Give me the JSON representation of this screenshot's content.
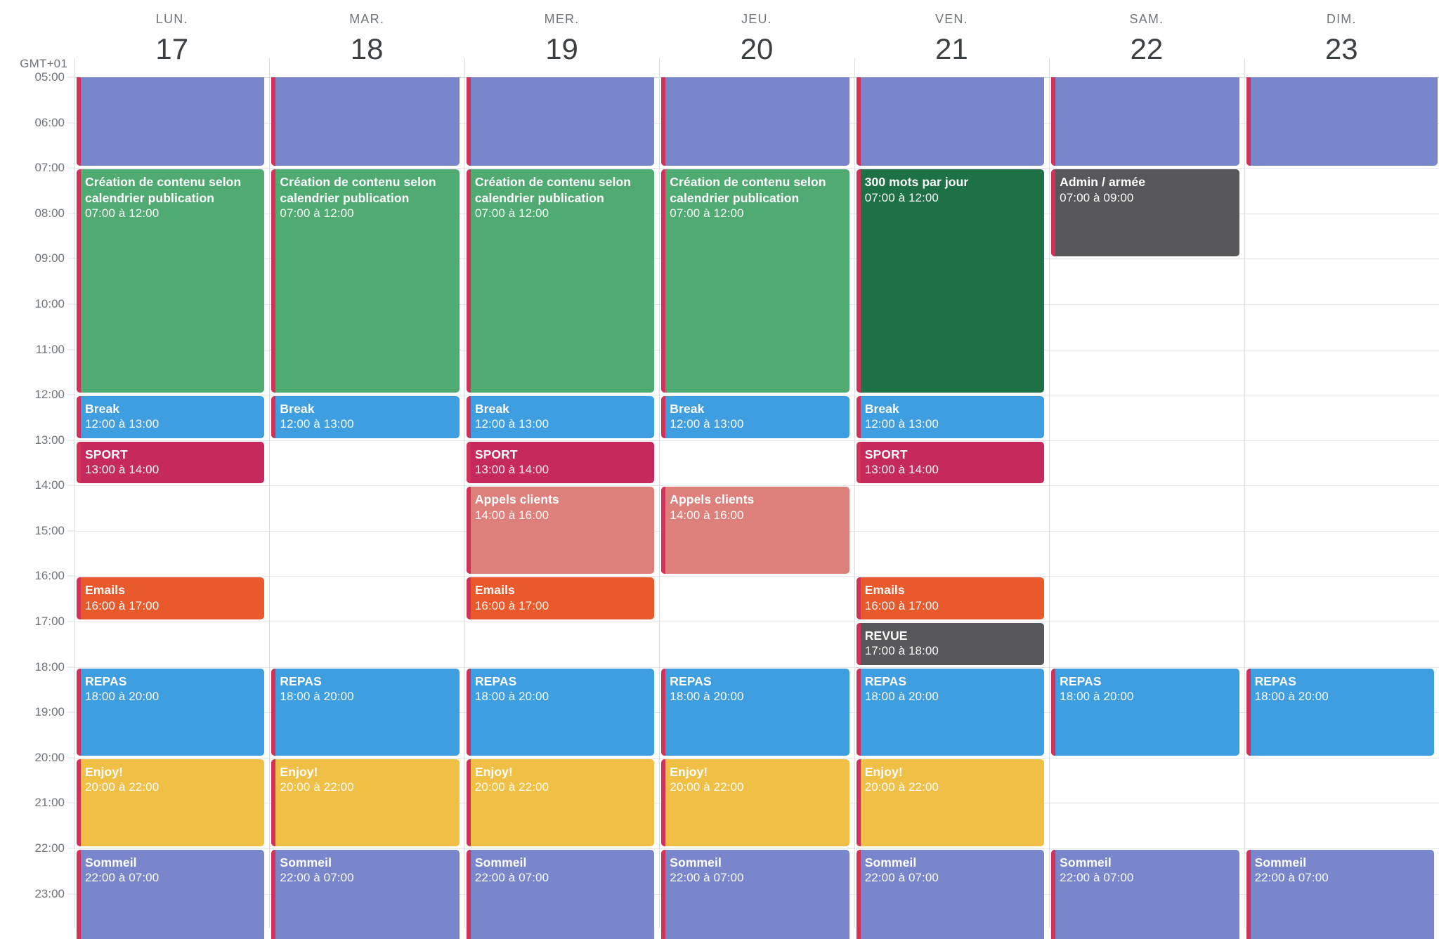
{
  "timezone_label": "GMT+01",
  "days": [
    {
      "dow": "LUN.",
      "date": "17"
    },
    {
      "dow": "MAR.",
      "date": "18"
    },
    {
      "dow": "MER.",
      "date": "19"
    },
    {
      "dow": "JEU.",
      "date": "20"
    },
    {
      "dow": "VEN.",
      "date": "21"
    },
    {
      "dow": "SAM.",
      "date": "22"
    },
    {
      "dow": "DIM.",
      "date": "23"
    }
  ],
  "hours": [
    "05:00",
    "06:00",
    "07:00",
    "08:00",
    "09:00",
    "10:00",
    "11:00",
    "12:00",
    "13:00",
    "14:00",
    "15:00",
    "16:00",
    "17:00",
    "18:00",
    "19:00",
    "20:00",
    "21:00",
    "22:00",
    "23:00"
  ],
  "colors": {
    "sleep_purple": "#7986cb",
    "content_green": "#50ab73",
    "words_dark_green": "#1e7145",
    "break_blue": "#3f9ee0",
    "meal_blue": "#3f9ee0",
    "sport_crimson": "#c6295c",
    "calls_salmon": "#dd7f7b",
    "emails_orange": "#e8592b",
    "review_gray": "#58585a",
    "admin_gray": "#58585a",
    "enjoy_yellow": "#efc045",
    "accent_bar": "#d2325a"
  },
  "events": [
    {
      "day": 0,
      "start": 5.0,
      "end": 7.0,
      "title": "Sommeil",
      "time": "",
      "color": "sleep_purple",
      "clip_top": true,
      "hide_text": true
    },
    {
      "day": 1,
      "start": 5.0,
      "end": 7.0,
      "title": "Sommeil",
      "time": "",
      "color": "sleep_purple",
      "clip_top": true,
      "hide_text": true
    },
    {
      "day": 2,
      "start": 5.0,
      "end": 7.0,
      "title": "Sommeil",
      "time": "",
      "color": "sleep_purple",
      "clip_top": true,
      "hide_text": true
    },
    {
      "day": 3,
      "start": 5.0,
      "end": 7.0,
      "title": "Sommeil",
      "time": "",
      "color": "sleep_purple",
      "clip_top": true,
      "hide_text": true
    },
    {
      "day": 4,
      "start": 5.0,
      "end": 7.0,
      "title": "Sommeil",
      "time": "",
      "color": "sleep_purple",
      "clip_top": true,
      "hide_text": true
    },
    {
      "day": 5,
      "start": 5.0,
      "end": 7.0,
      "title": "Sommeil",
      "time": "",
      "color": "sleep_purple",
      "clip_top": true,
      "hide_text": true
    },
    {
      "day": 6,
      "start": 5.0,
      "end": 7.0,
      "title": "Sommeil",
      "time": "",
      "color": "sleep_purple",
      "clip_top": true,
      "hide_text": true,
      "full_width": true
    },
    {
      "day": 0,
      "start": 7.0,
      "end": 12.0,
      "title": "Création de contenu selon calendrier publication",
      "time": "07:00 à 12:00",
      "color": "content_green"
    },
    {
      "day": 1,
      "start": 7.0,
      "end": 12.0,
      "title": "Création de contenu selon calendrier publication",
      "time": "07:00 à 12:00",
      "color": "content_green"
    },
    {
      "day": 2,
      "start": 7.0,
      "end": 12.0,
      "title": "Création de contenu selon calendrier publication",
      "time": "07:00 à 12:00",
      "color": "content_green"
    },
    {
      "day": 3,
      "start": 7.0,
      "end": 12.0,
      "title": "Création de contenu selon calendrier publication",
      "time": "07:00 à 12:00",
      "color": "content_green"
    },
    {
      "day": 4,
      "start": 7.0,
      "end": 12.0,
      "title": "300 mots par jour",
      "time": "07:00 à 12:00",
      "color": "words_dark_green"
    },
    {
      "day": 5,
      "start": 7.0,
      "end": 9.0,
      "title": "Admin / armée",
      "time": "07:00 à 09:00",
      "color": "admin_gray"
    },
    {
      "day": 0,
      "start": 12.0,
      "end": 13.0,
      "title": "Break",
      "time": "12:00 à 13:00",
      "color": "break_blue"
    },
    {
      "day": 1,
      "start": 12.0,
      "end": 13.0,
      "title": "Break",
      "time": "12:00 à 13:00",
      "color": "break_blue"
    },
    {
      "day": 2,
      "start": 12.0,
      "end": 13.0,
      "title": "Break",
      "time": "12:00 à 13:00",
      "color": "break_blue"
    },
    {
      "day": 3,
      "start": 12.0,
      "end": 13.0,
      "title": "Break",
      "time": "12:00 à 13:00",
      "color": "break_blue"
    },
    {
      "day": 4,
      "start": 12.0,
      "end": 13.0,
      "title": "Break",
      "time": "12:00 à 13:00",
      "color": "break_blue"
    },
    {
      "day": 0,
      "start": 13.0,
      "end": 14.0,
      "title": "SPORT",
      "time": "13:00 à 14:00",
      "color": "sport_crimson"
    },
    {
      "day": 2,
      "start": 13.0,
      "end": 14.0,
      "title": "SPORT",
      "time": "13:00 à 14:00",
      "color": "sport_crimson"
    },
    {
      "day": 4,
      "start": 13.0,
      "end": 14.0,
      "title": "SPORT",
      "time": "13:00 à 14:00",
      "color": "sport_crimson"
    },
    {
      "day": 2,
      "start": 14.0,
      "end": 16.0,
      "title": "Appels clients",
      "time": "14:00 à 16:00",
      "color": "calls_salmon"
    },
    {
      "day": 3,
      "start": 14.0,
      "end": 16.0,
      "title": "Appels clients",
      "time": "14:00 à 16:00",
      "color": "calls_salmon"
    },
    {
      "day": 0,
      "start": 16.0,
      "end": 17.0,
      "title": "Emails",
      "time": "16:00 à 17:00",
      "color": "emails_orange"
    },
    {
      "day": 2,
      "start": 16.0,
      "end": 17.0,
      "title": "Emails",
      "time": "16:00 à 17:00",
      "color": "emails_orange"
    },
    {
      "day": 4,
      "start": 16.0,
      "end": 17.0,
      "title": "Emails",
      "time": "16:00 à 17:00",
      "color": "emails_orange"
    },
    {
      "day": 4,
      "start": 17.0,
      "end": 18.0,
      "title": "REVUE",
      "time": "17:00 à 18:00",
      "color": "review_gray"
    },
    {
      "day": 0,
      "start": 18.0,
      "end": 20.0,
      "title": "REPAS",
      "time": "18:00 à 20:00",
      "color": "meal_blue"
    },
    {
      "day": 1,
      "start": 18.0,
      "end": 20.0,
      "title": "REPAS",
      "time": "18:00 à 20:00",
      "color": "meal_blue"
    },
    {
      "day": 2,
      "start": 18.0,
      "end": 20.0,
      "title": "REPAS",
      "time": "18:00 à 20:00",
      "color": "meal_blue"
    },
    {
      "day": 3,
      "start": 18.0,
      "end": 20.0,
      "title": "REPAS",
      "time": "18:00 à 20:00",
      "color": "meal_blue"
    },
    {
      "day": 4,
      "start": 18.0,
      "end": 20.0,
      "title": "REPAS",
      "time": "18:00 à 20:00",
      "color": "meal_blue"
    },
    {
      "day": 5,
      "start": 18.0,
      "end": 20.0,
      "title": "REPAS",
      "time": "18:00 à 20:00",
      "color": "meal_blue"
    },
    {
      "day": 6,
      "start": 18.0,
      "end": 20.0,
      "title": "REPAS",
      "time": "18:00 à 20:00",
      "color": "meal_blue"
    },
    {
      "day": 0,
      "start": 20.0,
      "end": 22.0,
      "title": "Enjoy!",
      "time": "20:00 à 22:00",
      "color": "enjoy_yellow"
    },
    {
      "day": 1,
      "start": 20.0,
      "end": 22.0,
      "title": "Enjoy!",
      "time": "20:00 à 22:00",
      "color": "enjoy_yellow"
    },
    {
      "day": 2,
      "start": 20.0,
      "end": 22.0,
      "title": "Enjoy!",
      "time": "20:00 à 22:00",
      "color": "enjoy_yellow"
    },
    {
      "day": 3,
      "start": 20.0,
      "end": 22.0,
      "title": "Enjoy!",
      "time": "20:00 à 22:00",
      "color": "enjoy_yellow"
    },
    {
      "day": 4,
      "start": 20.0,
      "end": 22.0,
      "title": "Enjoy!",
      "time": "20:00 à 22:00",
      "color": "enjoy_yellow"
    },
    {
      "day": 0,
      "start": 22.0,
      "end": 24.0,
      "title": "Sommeil",
      "time": "22:00 à 07:00",
      "color": "sleep_purple",
      "clip_bottom": true
    },
    {
      "day": 1,
      "start": 22.0,
      "end": 24.0,
      "title": "Sommeil",
      "time": "22:00 à 07:00",
      "color": "sleep_purple",
      "clip_bottom": true
    },
    {
      "day": 2,
      "start": 22.0,
      "end": 24.0,
      "title": "Sommeil",
      "time": "22:00 à 07:00",
      "color": "sleep_purple",
      "clip_bottom": true
    },
    {
      "day": 3,
      "start": 22.0,
      "end": 24.0,
      "title": "Sommeil",
      "time": "22:00 à 07:00",
      "color": "sleep_purple",
      "clip_bottom": true
    },
    {
      "day": 4,
      "start": 22.0,
      "end": 24.0,
      "title": "Sommeil",
      "time": "22:00 à 07:00",
      "color": "sleep_purple",
      "clip_bottom": true
    },
    {
      "day": 5,
      "start": 22.0,
      "end": 24.0,
      "title": "Sommeil",
      "time": "22:00 à 07:00",
      "color": "sleep_purple",
      "clip_bottom": true
    },
    {
      "day": 6,
      "start": 22.0,
      "end": 24.0,
      "title": "Sommeil",
      "time": "22:00 à 07:00",
      "color": "sleep_purple",
      "clip_bottom": true
    }
  ]
}
